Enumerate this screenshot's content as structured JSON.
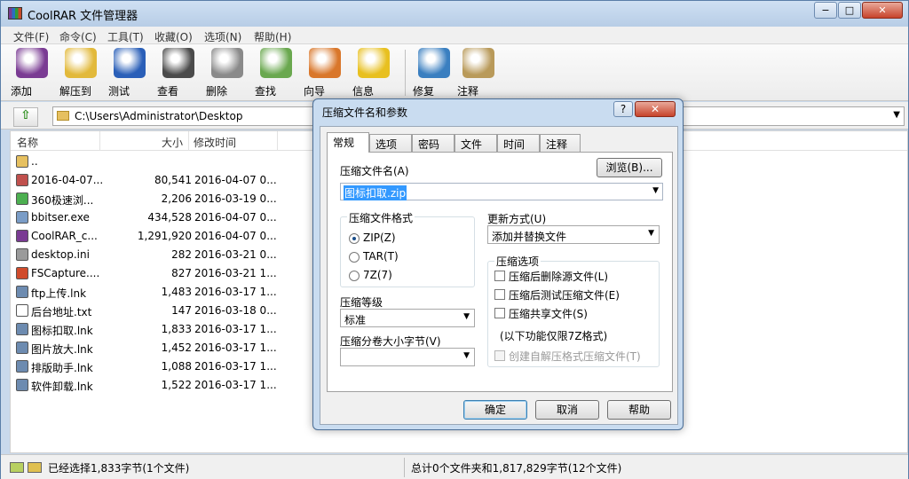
{
  "window": {
    "title": "CoolRAR 文件管理器",
    "min_label": "−",
    "max_label": "□",
    "close_label": "✕"
  },
  "menu": [
    "文件(F)",
    "命令(C)",
    "工具(T)",
    "收藏(O)",
    "选项(N)",
    "帮助(H)"
  ],
  "toolbar": [
    {
      "label": "添加",
      "icon": "books-icon",
      "color": "#7a3b93"
    },
    {
      "label": "解压到",
      "icon": "folder-extract-icon",
      "color": "#e2b93b"
    },
    {
      "label": "测试",
      "icon": "checkmark-icon",
      "color": "#2a5fb8"
    },
    {
      "label": "查看",
      "icon": "binoculars-icon",
      "color": "#4b4b4b"
    },
    {
      "label": "删除",
      "icon": "trash-icon",
      "color": "#8a8a8a"
    },
    {
      "label": "查找",
      "icon": "magnifier-icon",
      "color": "#6aa84f"
    },
    {
      "label": "向导",
      "icon": "wizard-person-icon",
      "color": "#d9772b"
    },
    {
      "label": "信息",
      "icon": "info-icon",
      "color": "#e8c020"
    },
    {
      "label": "修复",
      "icon": "first-aid-icon",
      "color": "#3a7fc0"
    },
    {
      "label": "注释",
      "icon": "clipboard-note-icon",
      "color": "#b99a5a"
    }
  ],
  "address": {
    "path": "C:\\Users\\Administrator\\Desktop",
    "up_icon": "up-arrow-icon"
  },
  "columns": {
    "name": "名称",
    "size": "大小",
    "modified": "修改时间"
  },
  "files": [
    {
      "name": "..",
      "size": "",
      "date": "",
      "icon": "folder-up-icon",
      "color": "#e6c060"
    },
    {
      "name": "2016-04-07...",
      "size": "80,541",
      "date": "2016-04-07 0...",
      "icon": "image-file-icon",
      "color": "#c0504d"
    },
    {
      "name": "360极速浏...",
      "size": "2,206",
      "date": "2016-03-19 0...",
      "icon": "browser-icon",
      "color": "#4caf50"
    },
    {
      "name": "bbitser.exe",
      "size": "434,528",
      "date": "2016-04-07 0...",
      "icon": "exe-icon",
      "color": "#7a9cc6"
    },
    {
      "name": "CoolRAR_c...",
      "size": "1,291,920",
      "date": "2016-04-07 0...",
      "icon": "archive-icon",
      "color": "#7a3b93"
    },
    {
      "name": "desktop.ini",
      "size": "282",
      "date": "2016-03-21 0...",
      "icon": "settings-file-icon",
      "color": "#9a9a9a"
    },
    {
      "name": "FSCapture....",
      "size": "827",
      "date": "2016-03-21 1...",
      "icon": "capture-icon",
      "color": "#d04b2b"
    },
    {
      "name": "ftp上传.lnk",
      "size": "1,483",
      "date": "2016-03-17 1...",
      "icon": "shortcut-icon",
      "color": "#6d8bb0"
    },
    {
      "name": "后台地址.txt",
      "size": "147",
      "date": "2016-03-18 0...",
      "icon": "text-file-icon",
      "color": "#ffffff"
    },
    {
      "name": "图标扣取.lnk",
      "size": "1,833",
      "date": "2016-03-17 1...",
      "icon": "shortcut-icon",
      "color": "#6d8bb0"
    },
    {
      "name": "图片放大.lnk",
      "size": "1,452",
      "date": "2016-03-17 1...",
      "icon": "shortcut-icon",
      "color": "#6d8bb0"
    },
    {
      "name": "排版助手.lnk",
      "size": "1,088",
      "date": "2016-03-17 1...",
      "icon": "shortcut-icon",
      "color": "#6d8bb0"
    },
    {
      "name": "软件卸载.lnk",
      "size": "1,522",
      "date": "2016-03-17 1...",
      "icon": "shortcut-icon",
      "color": "#6d8bb0"
    }
  ],
  "status": {
    "left": "已经选择1,833字节(1个文件)",
    "right": "总计0个文件夹和1,817,829字节(12个文件)"
  },
  "dialog": {
    "title": "压缩文件名和参数",
    "help_label": "?",
    "close_label": "✕",
    "tabs": [
      "常规",
      "选项",
      "密码",
      "文件",
      "时间",
      "注释"
    ],
    "archive_name_label": "压缩文件名(A)",
    "archive_name_value": "图标扣取.zip",
    "browse_label": "浏览(B)...",
    "format_group": "压缩文件格式",
    "formats": [
      "ZIP(Z)",
      "TAR(T)",
      "7Z(7)"
    ],
    "selected_format": "ZIP(Z)",
    "update_label": "更新方式(U)",
    "update_value": "添加并替换文件",
    "options_group": "压缩选项",
    "options": [
      "压缩后删除源文件(L)",
      "压缩后测试压缩文件(E)",
      "压缩共享文件(S)"
    ],
    "note_7z": "(以下功能仅限7Z格式)",
    "sfx_option": "创建自解压格式压缩文件(T)",
    "level_label": "压缩等级",
    "level_value": "标准",
    "volume_label": "压缩分卷大小字节(V)",
    "volume_value": "",
    "ok_label": "确定",
    "cancel_label": "取消",
    "helpbtn_label": "帮助"
  }
}
